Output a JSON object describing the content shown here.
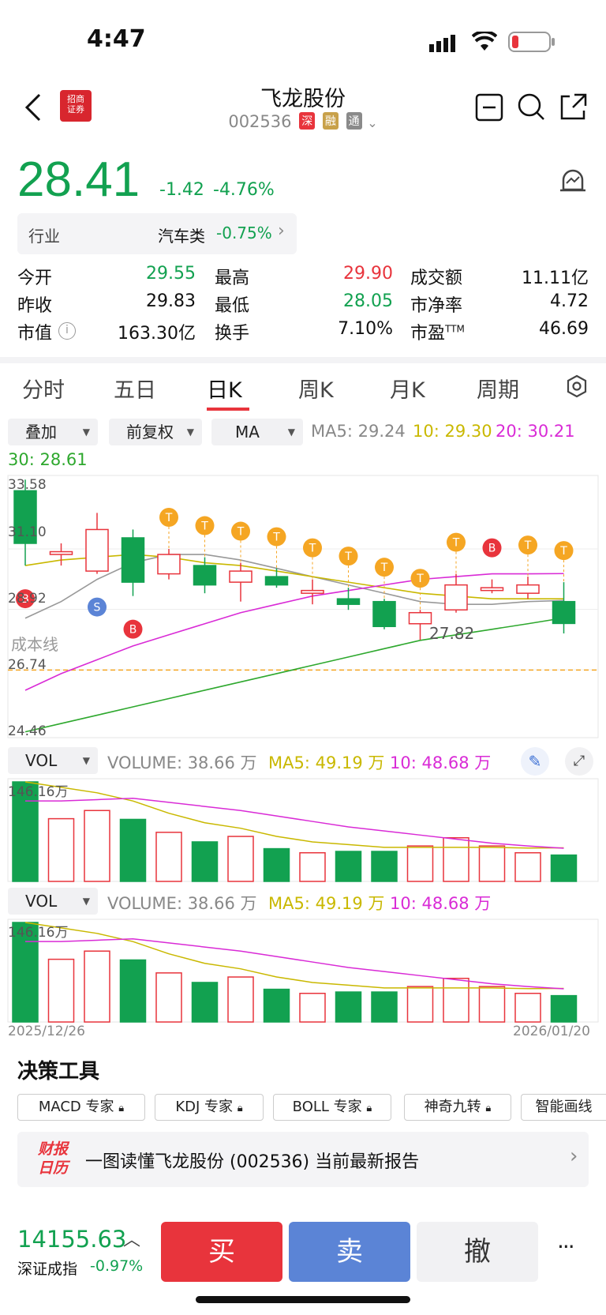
{
  "status_bar": {
    "time": "4:47"
  },
  "header": {
    "stock_name": "飞龙股份",
    "stock_code": "002536",
    "badges": [
      "深",
      "融",
      "通"
    ],
    "back_icon": "chevron-left-icon"
  },
  "quote": {
    "price": "28.41",
    "change": "-1.42",
    "change_pct": "-4.76%"
  },
  "industry": {
    "label": "行业",
    "name": "汽车类",
    "pct": "-0.75%"
  },
  "stats": {
    "open_label": "今开",
    "open": "29.55",
    "high_label": "最高",
    "high": "29.90",
    "turnover_amt_label": "成交额",
    "turnover_amt": "11.11亿",
    "prev_close_label": "昨收",
    "prev_close": "29.83",
    "low_label": "最低",
    "low": "28.05",
    "pb_label": "市净率",
    "pb": "4.72",
    "mcap_label": "市值",
    "mcap": "163.30亿",
    "turnover_label": "换手",
    "turnover": "7.10%",
    "pe_label": "市盈",
    "pe_sup": "TTM",
    "pe": "46.69"
  },
  "tabs": [
    "分时",
    "五日",
    "日K",
    "周K",
    "月K",
    "周期"
  ],
  "selected_tab": "日K",
  "kline_controls": {
    "overlay": "叠加",
    "adjust": "前复权",
    "indicator": "MA",
    "ma5": "MA5: 29.24",
    "ma10": "10: 29.30",
    "ma20": "20: 30.21",
    "ma30": "30: 28.61"
  },
  "kline": {
    "y_top": "33.58",
    "y_mid": "31.10",
    "y_mid2": "28.92",
    "y_low1": "26.74",
    "y_low2": "24.46",
    "cost_line_label": "成本线",
    "min_marker": "27.82",
    "date_start": "2025/12/26",
    "date_end": "2026/01/20"
  },
  "vol_panel": {
    "selector": "VOL",
    "volume": "VOLUME: 38.66 万",
    "ma5": "MA5: 49.19 万",
    "ma10": "10: 48.68 万",
    "y_top": "146.16万"
  },
  "chart_data": {
    "type": "candlestick",
    "candles": [
      {
        "o": 33.2,
        "c": 31.3,
        "h": 33.6,
        "l": 30.5
      },
      {
        "o": 30.9,
        "c": 31.0,
        "h": 31.3,
        "l": 30.5
      },
      {
        "o": 30.3,
        "c": 31.8,
        "h": 32.4,
        "l": 30.2
      },
      {
        "o": 31.5,
        "c": 29.9,
        "h": 31.8,
        "l": 29.4
      },
      {
        "o": 30.2,
        "c": 30.9,
        "h": 31.1,
        "l": 30.0
      },
      {
        "o": 30.5,
        "c": 29.8,
        "h": 30.8,
        "l": 29.5
      },
      {
        "o": 29.9,
        "c": 30.3,
        "h": 30.6,
        "l": 29.2
      },
      {
        "o": 30.1,
        "c": 29.8,
        "h": 30.4,
        "l": 29.7
      },
      {
        "o": 29.5,
        "c": 29.6,
        "h": 30.0,
        "l": 29.1
      },
      {
        "o": 29.3,
        "c": 29.1,
        "h": 29.7,
        "l": 28.9
      },
      {
        "o": 29.2,
        "c": 28.3,
        "h": 29.3,
        "l": 28.2
      },
      {
        "o": 28.4,
        "c": 28.8,
        "h": 28.9,
        "l": 27.82
      },
      {
        "o": 28.9,
        "c": 29.8,
        "h": 30.2,
        "l": 28.8
      },
      {
        "o": 29.6,
        "c": 29.7,
        "h": 30.0,
        "l": 29.5
      },
      {
        "o": 29.5,
        "c": 29.8,
        "h": 30.1,
        "l": 29.3
      },
      {
        "o": 29.2,
        "c": 28.41,
        "h": 29.9,
        "l": 28.05
      }
    ],
    "volume": [
      146,
      92,
      104,
      91,
      72,
      58,
      66,
      48,
      42,
      44,
      44,
      52,
      64,
      52,
      42,
      38.66
    ],
    "colors": {
      "up": "#e8343c",
      "down": "#12a150",
      "ma5": "#c9b800",
      "ma10": "#d92bd6",
      "ma20": "#888888",
      "ma30": "#2ea82e"
    }
  },
  "tools": {
    "title": "决策工具",
    "chips": [
      "MACD 专家",
      "KDJ 专家",
      "BOLL 专家",
      "神奇九转",
      "智能画线"
    ]
  },
  "report_banner": {
    "logo_top": "财报",
    "logo_bottom": "日历",
    "text": "一图读懂飞龙股份 (002536) 当前最新报告"
  },
  "index": {
    "value": "14155.63",
    "name": "深证成指",
    "pct": "-0.97%"
  },
  "actions": {
    "buy": "买",
    "sell": "卖",
    "cancel": "撤",
    "more": "···"
  }
}
